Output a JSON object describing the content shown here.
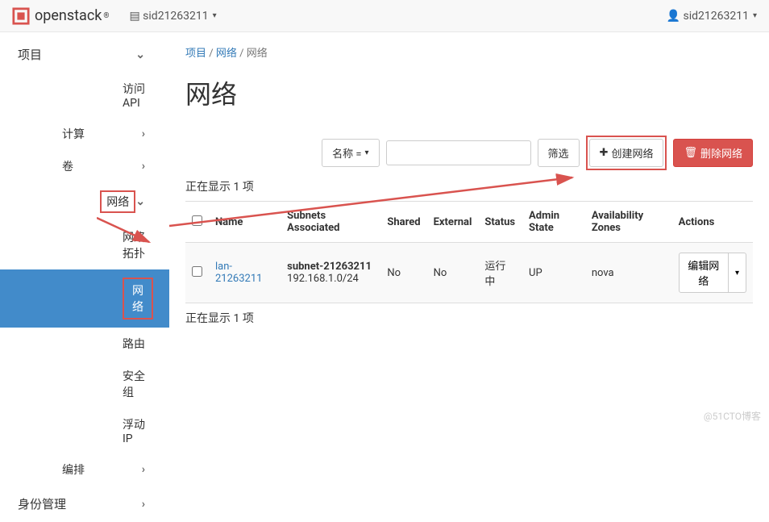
{
  "topbar": {
    "brand": "openstack",
    "domain_label": "sid21263211",
    "user_label": "sid21263211"
  },
  "sidebar": {
    "project": "项目",
    "api": "访问API",
    "compute": "计算",
    "volume": "卷",
    "network": "网络",
    "topology": "网络拓扑",
    "networks": "网络",
    "routers": "路由",
    "secgroups": "安全组",
    "floatingip": "浮动IP",
    "orchestration": "编排",
    "identity": "身份管理"
  },
  "breadcrumb": {
    "a": "项目",
    "b": "网络",
    "c": "网络"
  },
  "title": "网络",
  "toolbar": {
    "filter_label": "名称 =",
    "filter_btn": "筛选",
    "create": "创建网络",
    "delete": "删除网络"
  },
  "display_count": "正在显示 1 项",
  "columns": {
    "name": "Name",
    "subnets": "Subnets Associated",
    "shared": "Shared",
    "external": "External",
    "status": "Status",
    "admin": "Admin State",
    "az": "Availability Zones",
    "actions": "Actions"
  },
  "row": {
    "name": "lan-21263211",
    "subnet_name": "subnet-21263211",
    "subnet_cidr": "192.168.1.0/24",
    "shared": "No",
    "external": "No",
    "status": "运行中",
    "admin": "UP",
    "az": "nova",
    "edit": "编辑网络"
  },
  "watermark": "@51CTO博客"
}
